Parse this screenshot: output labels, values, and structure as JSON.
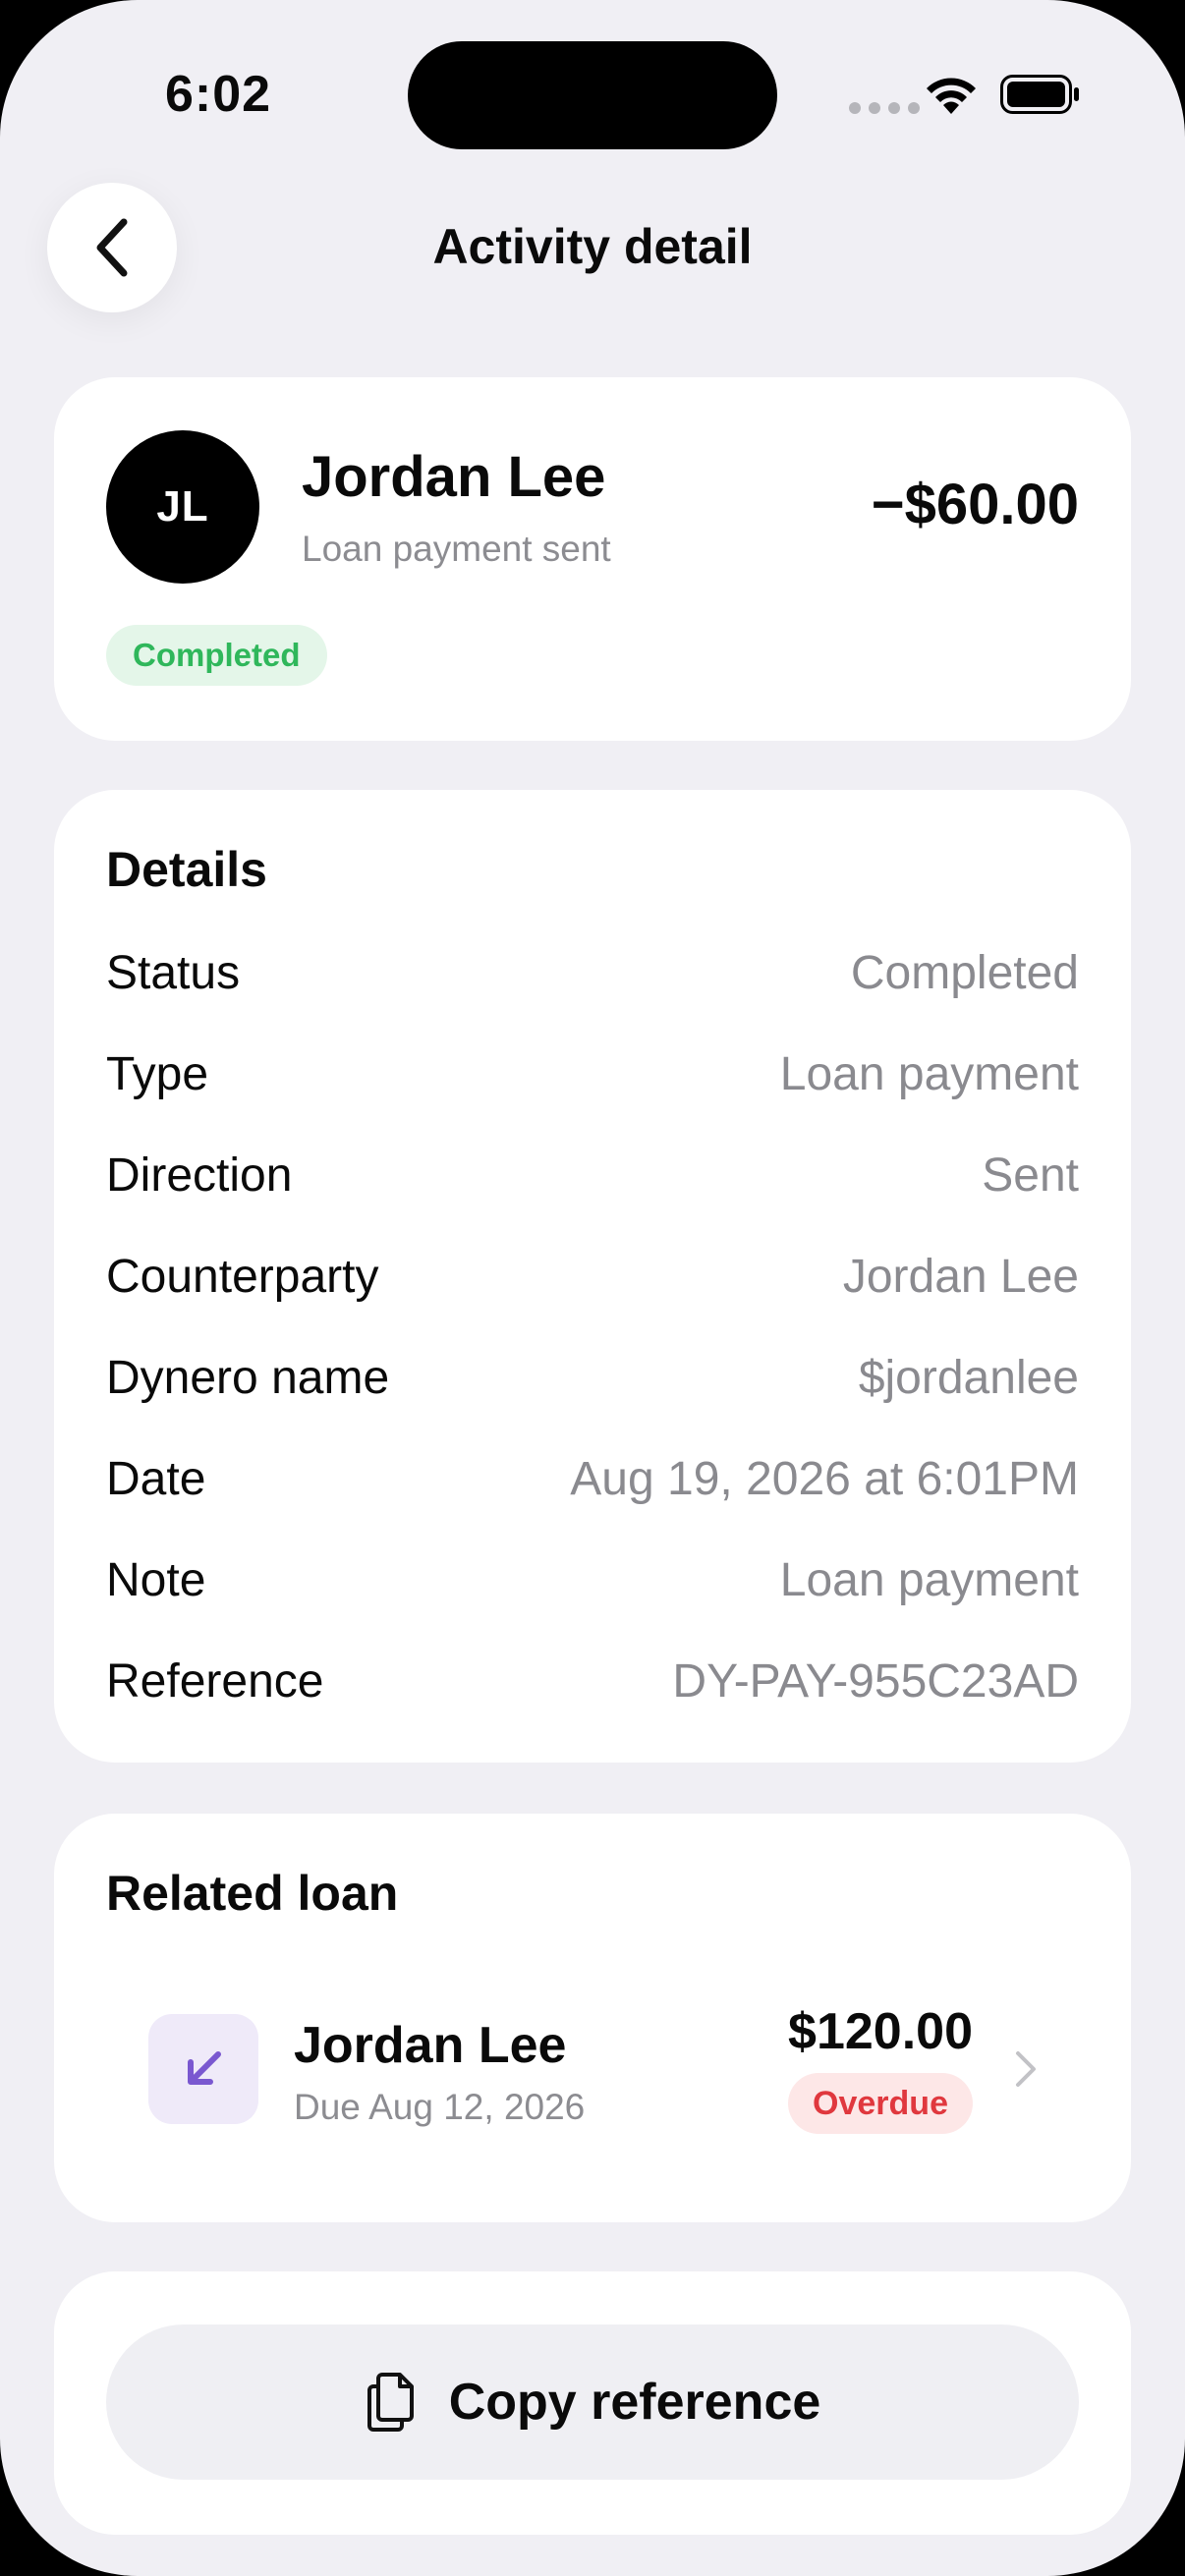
{
  "status_bar": {
    "time": "6:02"
  },
  "header": {
    "title": "Activity detail"
  },
  "summary": {
    "initials": "JL",
    "name": "Jordan Lee",
    "subtitle": "Loan payment sent",
    "amount": "−$60.00",
    "status_badge": "Completed"
  },
  "details": {
    "title": "Details",
    "rows": [
      {
        "label": "Status",
        "value": "Completed"
      },
      {
        "label": "Type",
        "value": "Loan payment"
      },
      {
        "label": "Direction",
        "value": "Sent"
      },
      {
        "label": "Counterparty",
        "value": "Jordan Lee"
      },
      {
        "label": "Dynero name",
        "value": "$jordanlee"
      },
      {
        "label": "Date",
        "value": "Aug 19, 2026 at 6:01PM"
      },
      {
        "label": "Note",
        "value": "Loan payment"
      },
      {
        "label": "Reference",
        "value": "DY-PAY-955C23AD"
      }
    ]
  },
  "related_loan": {
    "title": "Related loan",
    "name": "Jordan Lee",
    "due": "Due Aug 12, 2026",
    "amount": "$120.00",
    "status_badge": "Overdue",
    "icon": "arrow-down-left-icon"
  },
  "copy": {
    "label": "Copy reference",
    "icon": "document-copy-icon"
  },
  "colors": {
    "background": "#f0eff4",
    "completed_green": "#2fb75b",
    "overdue_red": "#e0383e",
    "loan_icon_purple": "#7a58d0"
  }
}
